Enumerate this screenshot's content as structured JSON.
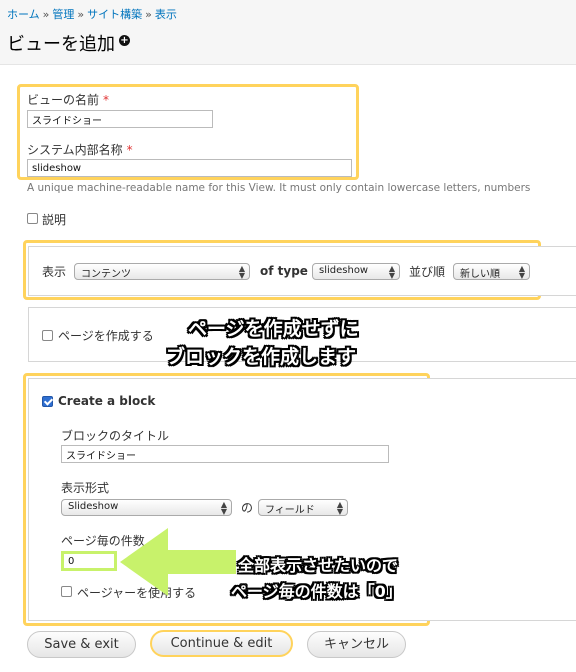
{
  "breadcrumb": [
    "ホーム",
    "管理",
    "サイト構築",
    "表示"
  ],
  "breadcrumb_sep": "»",
  "page_title": "ビューを追加",
  "shortcut_icon": "plus-circle-icon",
  "view_name": {
    "label": "ビューの名前",
    "required": "*",
    "value": "スライドショー"
  },
  "machine_name": {
    "label": "システム内部名称",
    "required": "*",
    "value": "slideshow",
    "description": "A unique machine-readable name for this View. It must only contain lowercase letters, numbers"
  },
  "description_toggle": {
    "label": "説明",
    "checked": false
  },
  "show": {
    "label": "表示",
    "value": "コンテンツ",
    "of_type_label": "of type",
    "type_value": "slideshow",
    "sort_label": "並び順",
    "sort_value": "新しい順"
  },
  "page": {
    "label": "ページを作成する",
    "checked": false
  },
  "annotation_top": [
    "ページを作成せずに",
    "ブロックを作成します"
  ],
  "block": {
    "label": "Create a block",
    "checked": true,
    "title_label": "ブロックのタイトル",
    "title_value": "スライドショー",
    "style_label": "表示形式",
    "style_value": "Slideshow",
    "of_label": "の",
    "row_value": "フィールド",
    "items_label": "ページ毎の件数",
    "items_value": "0",
    "pager_label": "ページャーを使用する",
    "pager_checked": false
  },
  "annotation_bottom": [
    "全部表示させたいので",
    "ページ毎の件数は「0」"
  ],
  "buttons": {
    "save_exit": "Save & exit",
    "continue_edit": "Continue & edit",
    "cancel": "キャンセル"
  },
  "colors": {
    "highlight": "#ffd35c",
    "link": "#0074bd",
    "arrow": "#c8f26b"
  }
}
